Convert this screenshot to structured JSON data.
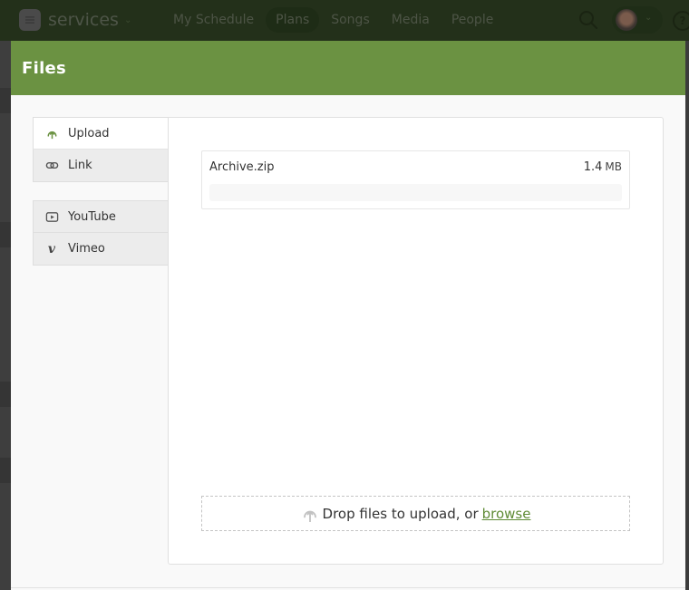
{
  "topnav": {
    "app_name": "services",
    "links": [
      {
        "label": "My Schedule",
        "active": false
      },
      {
        "label": "Plans",
        "active": true
      },
      {
        "label": "Songs",
        "active": false
      },
      {
        "label": "Media",
        "active": false
      },
      {
        "label": "People",
        "active": false
      }
    ],
    "help_glyph": "?"
  },
  "modal": {
    "title": "Files",
    "tabs_group1": [
      {
        "label": "Upload",
        "icon": "cloud-upload-icon",
        "active": true
      },
      {
        "label": "Link",
        "icon": "link-icon",
        "active": false
      }
    ],
    "tabs_group2": [
      {
        "label": "YouTube",
        "icon": "youtube-icon",
        "active": false
      },
      {
        "label": "Vimeo",
        "icon": "vimeo-icon",
        "active": false
      }
    ],
    "files": [
      {
        "name": "Archive.zip",
        "size_value": "1.4",
        "size_unit": "MB",
        "progress_percent": 0
      }
    ],
    "dropzone": {
      "text": "Drop files to upload, or",
      "link": "browse"
    }
  },
  "colors": {
    "accent": "#6b9242",
    "link": "#5f8b36"
  }
}
